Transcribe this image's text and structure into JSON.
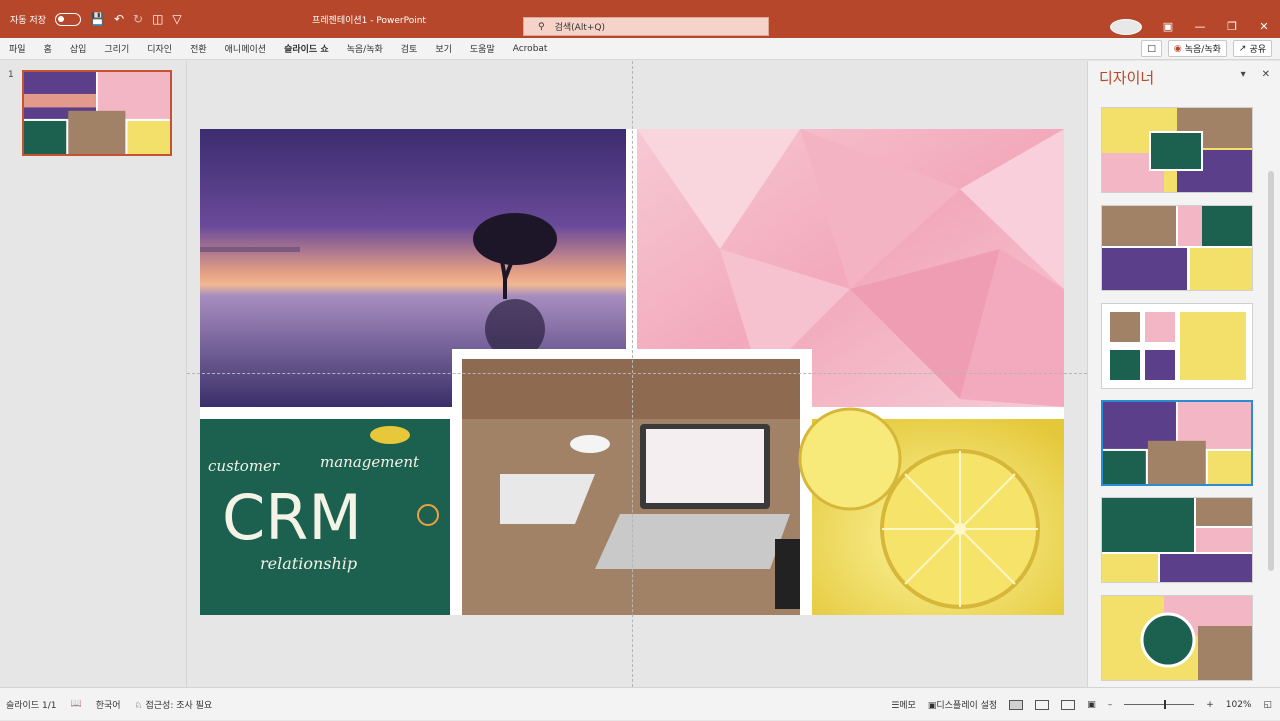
{
  "titlebar": {
    "autosave_label": "자동 저장",
    "doc_title": "프레젠테이션1  -  PowerPoint",
    "search_placeholder": "검색(Alt+Q)"
  },
  "ribbon": {
    "tabs": [
      "파일",
      "홈",
      "삽입",
      "그리기",
      "디자인",
      "전환",
      "애니메이션",
      "슬라이드 쇼",
      "녹음/녹화",
      "검토",
      "보기",
      "도움말",
      "Acrobat"
    ],
    "record_label": "녹음/녹화",
    "share_label": "공유"
  },
  "thumbnails": {
    "slide_number": "1"
  },
  "designer": {
    "title": "디자이너"
  },
  "statusbar": {
    "slide_info": "슬라이드 1/1",
    "language": "한국어",
    "accessibility": "접근성: 조사 필요",
    "notes": "메모",
    "display_settings": "디스플레이 설정",
    "zoom": "102%"
  },
  "slide_images": {
    "crm_customer": "customer",
    "crm_management": "management",
    "crm_title": "CRM",
    "crm_relationship": "relationship"
  },
  "colors": {
    "accent": "#b7472a",
    "selection": "#2b8cd6"
  }
}
